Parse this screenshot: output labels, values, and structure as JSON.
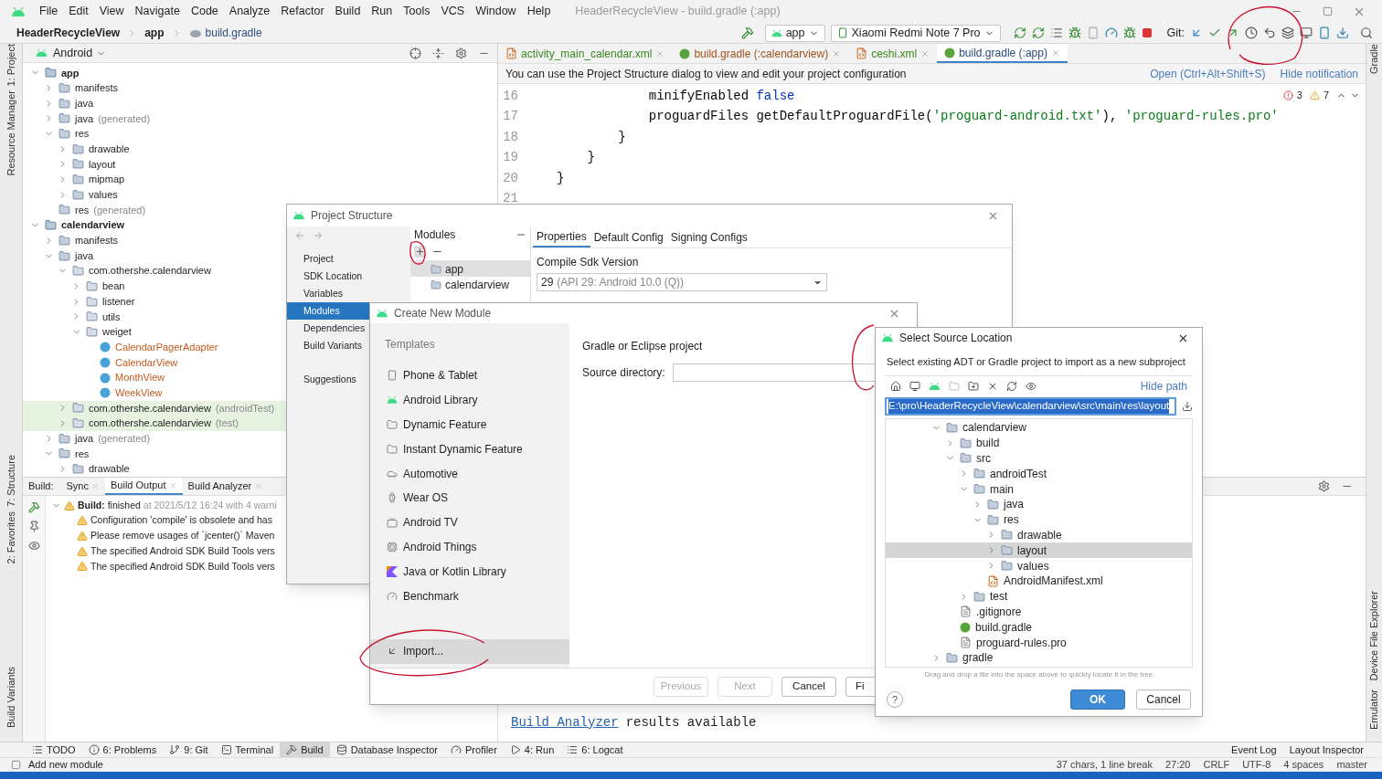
{
  "menu_bar": {
    "items": [
      "File",
      "Edit",
      "View",
      "Navigate",
      "Code",
      "Analyze",
      "Refactor",
      "Build",
      "Run",
      "Tools",
      "VCS",
      "Window",
      "Help"
    ],
    "title": "HeaderRecycleView - build.gradle (:app)"
  },
  "breadcrumbs": [
    "HeaderRecycleView",
    "app",
    "build.gradle"
  ],
  "toolbar": {
    "run_config": "app",
    "device": "Xiaomi Redmi Note 7 Pro",
    "git_label": "Git:"
  },
  "left_stripe": [
    "1: Project",
    "Resource Manager",
    "7: Structure",
    "2: Favorites",
    "Build Variants"
  ],
  "right_stripe": [
    "Gradle",
    "Device File Explorer",
    "Emulator"
  ],
  "project_panel": {
    "view": "Android",
    "tree": [
      {
        "label": "app",
        "kind": "module",
        "expanded": true,
        "children": [
          {
            "label": "manifests",
            "kind": "folder",
            "expanded": false
          },
          {
            "label": "java",
            "kind": "folder",
            "expanded": false
          },
          {
            "label": "java",
            "suffix": "(generated)",
            "kind": "folder",
            "expanded": false
          },
          {
            "label": "res",
            "kind": "folder",
            "expanded": true,
            "children": [
              {
                "label": "drawable",
                "kind": "folder",
                "expanded": false
              },
              {
                "label": "layout",
                "kind": "folder",
                "expanded": false
              },
              {
                "label": "mipmap",
                "kind": "folder",
                "expanded": false
              },
              {
                "label": "values",
                "kind": "folder",
                "expanded": false
              }
            ]
          },
          {
            "label": "res",
            "suffix": "(generated)",
            "kind": "folder"
          }
        ]
      },
      {
        "label": "calendarview",
        "kind": "module",
        "expanded": true,
        "children": [
          {
            "label": "manifests",
            "kind": "folder",
            "expanded": false
          },
          {
            "label": "java",
            "kind": "folder",
            "expanded": true,
            "children": [
              {
                "label": "com.othershe.calendarview",
                "kind": "package",
                "expanded": true,
                "children": [
                  {
                    "label": "bean",
                    "kind": "package",
                    "expanded": false
                  },
                  {
                    "label": "listener",
                    "kind": "package",
                    "expanded": false
                  },
                  {
                    "label": "utils",
                    "kind": "package",
                    "expanded": false
                  },
                  {
                    "label": "weiget",
                    "kind": "package",
                    "expanded": true,
                    "children": [
                      {
                        "label": "CalendarPagerAdapter",
                        "kind": "class"
                      },
                      {
                        "label": "CalendarView",
                        "kind": "class"
                      },
                      {
                        "label": "MonthView",
                        "kind": "class"
                      },
                      {
                        "label": "WeekView",
                        "kind": "class"
                      }
                    ]
                  }
                ]
              },
              {
                "label": "com.othershe.calendarview",
                "suffix": "(androidTest)",
                "kind": "test-package",
                "expanded": false
              },
              {
                "label": "com.othershe.calendarview",
                "suffix": "(test)",
                "kind": "test-package",
                "expanded": false
              }
            ]
          },
          {
            "label": "java",
            "suffix": "(generated)",
            "kind": "folder",
            "expanded": false
          },
          {
            "label": "res",
            "kind": "folder",
            "expanded": true,
            "children": [
              {
                "label": "drawable",
                "kind": "folder",
                "expanded": false
              }
            ]
          }
        ]
      }
    ]
  },
  "editor": {
    "tabs": [
      {
        "label": "activity_main_calendar.xml",
        "kind": "xml",
        "selected": false
      },
      {
        "label": "build.gradle (:calendarview)",
        "kind": "gradle",
        "selected": false
      },
      {
        "label": "ceshi.xml",
        "kind": "xml",
        "selected": false
      },
      {
        "label": "build.gradle (:app)",
        "kind": "gradle",
        "selected": true
      }
    ],
    "notification": {
      "text": "You can use the Project Structure dialog to view and edit your project configuration",
      "link": "Open (Ctrl+Alt+Shift+S)",
      "hide": "Hide notification"
    },
    "inspections": {
      "errors": "3",
      "warnings": "7"
    },
    "lines": [
      {
        "number": "16",
        "tokens": [
          {
            "text": "            minifyEnabled ",
            "kind": "plain"
          },
          {
            "text": "false",
            "kind": "keyword"
          }
        ]
      },
      {
        "number": "17",
        "tokens": [
          {
            "text": "            proguardFiles getDefaultProguardFile(",
            "kind": "plain"
          },
          {
            "text": "'proguard-android.txt'",
            "kind": "string"
          },
          {
            "text": "), ",
            "kind": "plain"
          },
          {
            "text": "'proguard-rules.pro'",
            "kind": "string"
          }
        ]
      },
      {
        "number": "18",
        "tokens": [
          {
            "text": "        }",
            "kind": "plain"
          }
        ]
      },
      {
        "number": "19",
        "tokens": [
          {
            "text": "    }",
            "kind": "plain"
          }
        ]
      },
      {
        "number": "20",
        "tokens": [
          {
            "text": "}",
            "kind": "plain"
          }
        ]
      },
      {
        "number": "21"
      }
    ]
  },
  "build_panel": {
    "label": "Build:",
    "tabs": [
      {
        "label": "Sync",
        "selected": false
      },
      {
        "label": "Build Output",
        "selected": true
      },
      {
        "label": "Build Analyzer",
        "selected": false
      }
    ],
    "result": {
      "title": "**Build:** finished",
      "detail": "at 2021/5/12 16:24 with 4 warni"
    },
    "warnings": [
      "Configuration 'compile' is obsolete and has",
      "Please remove usages of `jcenter()` Maven",
      "The specified Android SDK Build Tools vers",
      "The specified Android SDK Build Tools vers"
    ],
    "output": {
      "link": "Build Analyzer",
      "text": "results available"
    }
  },
  "tool_windows": [
    {
      "label": "TODO",
      "kind": "todo",
      "selected": false
    },
    {
      "label": "6: Problems",
      "kind": "problems",
      "selected": false
    },
    {
      "label": "9: Git",
      "kind": "git",
      "selected": false
    },
    {
      "label": "Terminal",
      "kind": "terminal",
      "selected": false
    },
    {
      "label": "Build",
      "kind": "build",
      "selected": true
    },
    {
      "label": "Database Inspector",
      "kind": "database",
      "selected": false
    },
    {
      "label": "Profiler",
      "kind": "profiler",
      "selected": false
    },
    {
      "label": "4: Run",
      "kind": "run",
      "selected": false
    },
    {
      "label": "6: Logcat",
      "kind": "logcat",
      "selected": false
    }
  ],
  "tool_windows_right": [
    "Event Log",
    "Layout Inspector"
  ],
  "status_bar": {
    "message": "Add new module",
    "items": [
      "37 chars, 1 line break",
      "27:20",
      "CRLF",
      "UTF-8",
      "4 spaces",
      "master"
    ]
  },
  "project_structure": {
    "title": "Project Structure",
    "nav": [
      {
        "label": "Project",
        "selected": false
      },
      {
        "label": "SDK Location",
        "selected": false
      },
      {
        "label": "Variables",
        "selected": false
      },
      {
        "label": "Modules",
        "selected": true
      },
      {
        "label": "Dependencies",
        "selected": false
      },
      {
        "label": "Build Variants",
        "selected": false
      },
      {
        "label": "Suggestions",
        "selected": false
      }
    ],
    "modules_header": "Modules",
    "modules": [
      {
        "label": "app",
        "selected": true
      },
      {
        "label": "calendarview",
        "selected": false
      }
    ],
    "tabs": [
      {
        "label": "Properties",
        "selected": true
      },
      {
        "label": "Default Config",
        "selected": false
      },
      {
        "label": "Signing Configs",
        "selected": false
      }
    ],
    "field_label": "Compile Sdk Version",
    "field_value": "29",
    "field_detail": "(API 29: Android 10.0 (Q))"
  },
  "create_module": {
    "title": "Create New Module",
    "templates_label": "Templates",
    "templates": [
      {
        "label": "Phone & Tablet",
        "kind": "phone",
        "selected": false
      },
      {
        "label": "Android Library",
        "kind": "android",
        "selected": false
      },
      {
        "label": "Dynamic Feature",
        "kind": "folder",
        "selected": false
      },
      {
        "label": "Instant Dynamic Feature",
        "kind": "folder",
        "selected": false
      },
      {
        "label": "Automotive",
        "kind": "car",
        "selected": false
      },
      {
        "label": "Wear OS",
        "kind": "watch",
        "selected": false
      },
      {
        "label": "Android TV",
        "kind": "tv",
        "selected": false
      },
      {
        "label": "Android Things",
        "kind": "chip",
        "selected": false
      },
      {
        "label": "Java or Kotlin Library",
        "kind": "kotlin",
        "selected": false
      },
      {
        "label": "Benchmark",
        "kind": "gauge",
        "selected": false
      },
      {
        "label": "Import...",
        "kind": "import",
        "selected": true
      }
    ],
    "heading": "Gradle or Eclipse project",
    "source_label": "Source directory:",
    "buttons": [
      {
        "label": "Previous",
        "disabled": true
      },
      {
        "label": "Next",
        "disabled": true
      },
      {
        "label": "Cancel",
        "disabled": false
      },
      {
        "label": "Fi",
        "disabled": false
      }
    ]
  },
  "select_source": {
    "title": "Select Source Location",
    "description": "Select existing ADT or Gradle project to import as a new subproject",
    "hide_path": "Hide path",
    "path": "E:\\pro\\HeaderRecycleView\\calendarview\\src\\main\\res\\layout",
    "tree": [
      {
        "label": "calendarview",
        "kind": "folder",
        "expanded": true,
        "selected": false,
        "children": [
          {
            "label": "build",
            "kind": "folder",
            "expanded": false,
            "selected": false
          },
          {
            "label": "src",
            "kind": "folder",
            "expanded": true,
            "selected": false,
            "children": [
              {
                "label": "androidTest",
                "kind": "folder",
                "expanded": false,
                "selected": false
              },
              {
                "label": "main",
                "kind": "folder",
                "expanded": true,
                "selected": false,
                "children": [
                  {
                    "label": "java",
                    "kind": "folder",
                    "expanded": false,
                    "selected": false
                  },
                  {
                    "label": "res",
                    "kind": "folder",
                    "expanded": true,
                    "selected": false,
                    "children": [
                      {
                        "label": "drawable",
                        "kind": "folder",
                        "expanded": false,
                        "selected": false
                      },
                      {
                        "label": "layout",
                        "kind": "folder",
                        "expanded": false,
                        "selected": true
                      },
                      {
                        "label": "values",
                        "kind": "folder",
                        "expanded": false,
                        "selected": false
                      }
                    ]
                  },
                  {
                    "label": "AndroidManifest.xml",
                    "kind": "xml",
                    "selected": false
                  }
                ]
              },
              {
                "label": "test",
                "kind": "folder",
                "expanded": false,
                "selected": false
              }
            ]
          },
          {
            "label": ".gitignore",
            "kind": "file",
            "selected": false
          },
          {
            "label": "build.gradle",
            "kind": "gradle",
            "selected": false
          },
          {
            "label": "proguard-rules.pro",
            "kind": "file",
            "selected": false
          }
        ]
      },
      {
        "label": "gradle",
        "kind": "folder",
        "expanded": false,
        "selected": false
      }
    ],
    "hint": "Drag and drop a file into the space above to quickly locate it in the tree",
    "help": "?",
    "buttons": [
      {
        "label": "OK",
        "default": true
      },
      {
        "label": "Cancel",
        "default": false
      }
    ]
  }
}
